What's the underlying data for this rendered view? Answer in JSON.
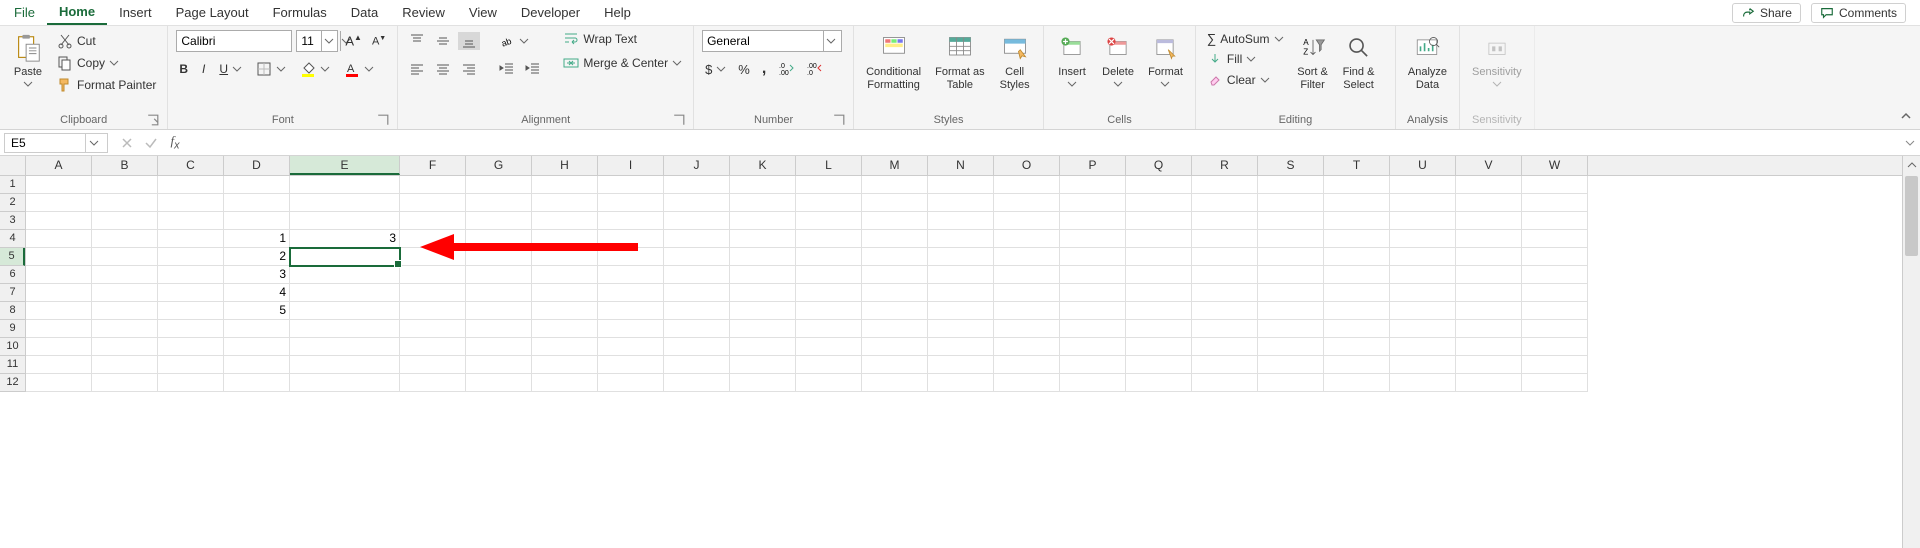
{
  "tabs": {
    "file": "File",
    "home": "Home",
    "insert": "Insert",
    "pageLayout": "Page Layout",
    "formulas": "Formulas",
    "data": "Data",
    "review": "Review",
    "view": "View",
    "developer": "Developer",
    "help": "Help"
  },
  "topright": {
    "share": "Share",
    "comments": "Comments"
  },
  "ribbon": {
    "clipboard": {
      "paste": "Paste",
      "cut": "Cut",
      "copy": "Copy",
      "formatPainter": "Format Painter",
      "label": "Clipboard"
    },
    "font": {
      "name": "Calibri",
      "size": "11",
      "label": "Font"
    },
    "alignment": {
      "wrap": "Wrap Text",
      "merge": "Merge & Center",
      "label": "Alignment"
    },
    "number": {
      "format": "General",
      "label": "Number"
    },
    "styles": {
      "cond": "Conditional\nFormatting",
      "table": "Format as\nTable",
      "cell": "Cell\nStyles",
      "label": "Styles"
    },
    "cells": {
      "insert": "Insert",
      "delete": "Delete",
      "format": "Format",
      "label": "Cells"
    },
    "editing": {
      "autosum": "AutoSum",
      "fill": "Fill",
      "clear": "Clear",
      "sort": "Sort &\nFilter",
      "find": "Find &\nSelect",
      "label": "Editing"
    },
    "analysis": {
      "analyze": "Analyze\nData",
      "label": "Analysis"
    },
    "sensitivity": {
      "btn": "Sensitivity",
      "label": "Sensitivity"
    }
  },
  "namebox": "E5",
  "formula": "",
  "columns": [
    "A",
    "B",
    "C",
    "D",
    "E",
    "F",
    "G",
    "H",
    "I",
    "J",
    "K",
    "L",
    "M",
    "N",
    "O",
    "P",
    "Q",
    "R",
    "S",
    "T",
    "U",
    "V",
    "W"
  ],
  "rows": [
    "1",
    "2",
    "3",
    "4",
    "5",
    "6",
    "7",
    "8",
    "9",
    "10",
    "11",
    "12"
  ],
  "activeCol": "E",
  "activeRow": "5",
  "cellData": {
    "D4": "1",
    "D5": "2",
    "D6": "3",
    "D7": "4",
    "D8": "5",
    "E4": "3"
  },
  "wideCol": "E"
}
